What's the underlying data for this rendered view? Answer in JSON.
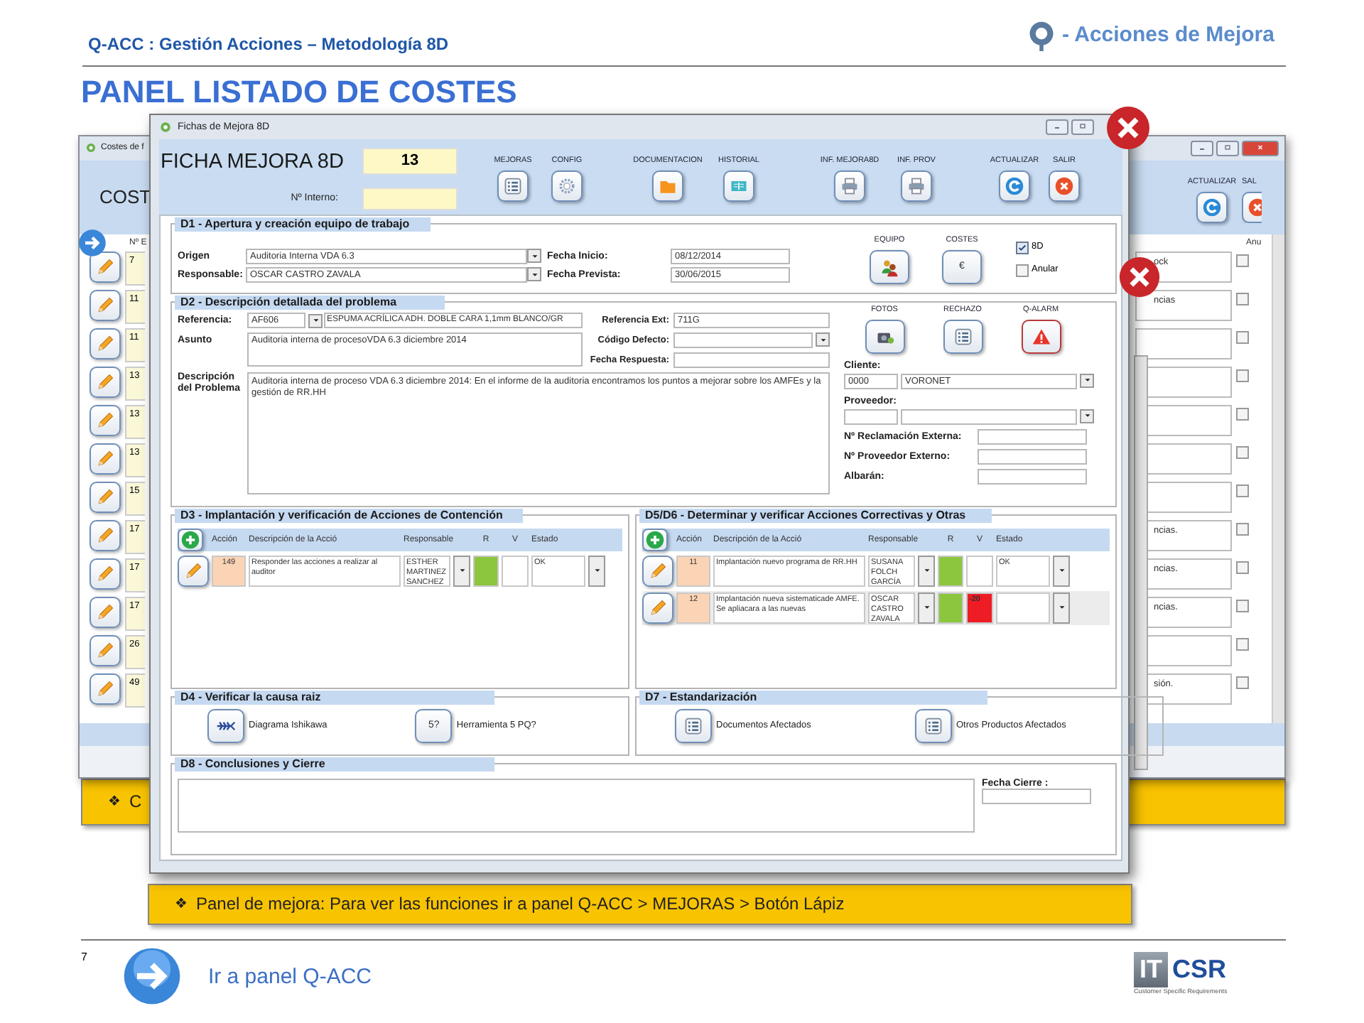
{
  "header": {
    "title": "Q-ACC : Gestión Acciones – Metodología 8D",
    "brand": "- Acciones de Mejora"
  },
  "slide_title": "PANEL LISTADO DE COSTES",
  "back_window": {
    "title": "Costes de f",
    "heading": "COST",
    "column_first": "Nº E",
    "column_last": "Anu",
    "toolbar": [
      {
        "label": "ACTUALIZAR",
        "kind": "refresh"
      },
      {
        "label": "SAL",
        "kind": "close"
      }
    ],
    "rows": [
      {
        "number": "7",
        "note": "ock",
        "annulled": false
      },
      {
        "number": "11",
        "note": "ncias",
        "annulled": false
      },
      {
        "number": "11",
        "annulled": false
      },
      {
        "number": "13",
        "annulled": false
      },
      {
        "number": "13",
        "annulled": false
      },
      {
        "number": "13",
        "annulled": false
      },
      {
        "number": "15",
        "annulled": false
      },
      {
        "number": "17",
        "note": "ncias.",
        "annulled": false
      },
      {
        "number": "17",
        "note": "ncias.",
        "annulled": false
      },
      {
        "number": "17",
        "note": "ncias.",
        "annulled": false
      },
      {
        "number": "26",
        "annulled": false
      },
      {
        "number": "49",
        "note": "sión.",
        "annulled": false
      }
    ]
  },
  "front_window": {
    "title": "Fichas de Mejora 8D",
    "heading": "FICHA MEJORA 8D",
    "number": "13",
    "internal_label": "Nº Interno:",
    "toolbar": [
      {
        "label": "MEJORAS",
        "kind": "list"
      },
      {
        "label": "CONFIG",
        "kind": "gear"
      },
      {
        "label": "DOCUMENTACION",
        "kind": "folder"
      },
      {
        "label": "HISTORIAL",
        "kind": "book"
      },
      {
        "label": "INF. MEJORA8D",
        "kind": "printer"
      },
      {
        "label": "INF. PROV",
        "kind": "printer"
      },
      {
        "label": "ACTUALIZAR",
        "kind": "refresh"
      },
      {
        "label": "SALIR",
        "kind": "close"
      }
    ],
    "d1": {
      "title": "D1 - Apertura y creación equipo de trabajo",
      "fields": [
        {
          "label": "Origen",
          "value": "Auditoria Interna VDA 6.3"
        },
        {
          "label": "Responsable:",
          "value": "OSCAR  CASTRO ZAVALA"
        }
      ],
      "dates": [
        {
          "label": "Fecha Inicio:",
          "value": "08/12/2014"
        },
        {
          "label": "Fecha Prevista:",
          "value": "30/06/2015"
        }
      ],
      "buttons": [
        {
          "label": "EQUIPO",
          "kind": "team"
        },
        {
          "label": "COSTES",
          "kind": "symbol",
          "symbol": "€"
        }
      ],
      "checks": [
        {
          "label": "8D",
          "checked": true
        },
        {
          "label": "Anular",
          "checked": false
        }
      ]
    },
    "d2": {
      "title": "D2 - Descripción detallada del problema",
      "reference_label": "Referencia:",
      "reference": "AF606",
      "reference_desc": "ESPUMA ACRÍLICA ADH. DOBLE CARA 1,1mm BLANCO/GR",
      "subject_label": "Asunto",
      "subject": "Auditoria interna de procesoVDA 6.3 diciembre 2014",
      "side_fields": [
        {
          "label": "Referencia Ext:",
          "value": "711G",
          "kind": "text"
        },
        {
          "label": "Código Defecto:",
          "kind": "dropdown"
        },
        {
          "label": "Fecha Respuesta:",
          "kind": "text"
        }
      ],
      "description_label": "Descripción del Problema",
      "description": "Auditoria interna de proceso VDA 6.3 diciembre 2014: En el informe de la auditoria encontramos los puntos a mejorar sobre los AMFEs y la gestión de RR.HH",
      "buttons": [
        {
          "label": "FOTOS",
          "kind": "camera"
        },
        {
          "label": "RECHAZO",
          "kind": "list"
        },
        {
          "label": "Q-ALARM",
          "kind": "alert"
        }
      ],
      "client_label": "Cliente:",
      "client_code": "0000",
      "client_name": "VORONET",
      "supplier_label": "Proveedor:",
      "extra_fields": [
        {
          "label": "Nº Reclamación Externa:"
        },
        {
          "label": "Nº Proveedor Externo:"
        },
        {
          "label": "Albarán:"
        }
      ]
    },
    "d3": {
      "title": "D3 - Implantación y verificación de Acciones de Contención",
      "columns": [
        "Acción",
        "Descripción de la Acció",
        "Responsable",
        "R",
        "V",
        "Estado"
      ],
      "rows": [
        {
          "number": "149",
          "description": "Responder las acciones a realizar al auditor",
          "responsible": "ESTHER MARTINEZ SANCHEZ",
          "r": {
            "color": "#8cc63e"
          },
          "v": {
            "color": "#ffffff"
          },
          "status": "OK",
          "selected": false
        }
      ]
    },
    "d5_d6": {
      "title": "D5/D6 - Determinar y verificar Acciones Correctivas y Otras",
      "columns": [
        "Acción",
        "Descripción de la Acció",
        "Responsable",
        "R",
        "V",
        "Estado"
      ],
      "rows": [
        {
          "number": "11",
          "description": "Implantación nuevo programa de RR.HH",
          "responsible": "SUSANA FOLCH GARCÍA",
          "r": {
            "color": "#8cc63e"
          },
          "v": {
            "color": "#ffffff"
          },
          "status": "OK",
          "selected": false
        },
        {
          "number": "12",
          "description": "Implantación nueva sistematicade AMFE. Se apliacara a las nuevas",
          "responsible": "OSCAR CASTRO ZAVALA",
          "r": {
            "color": "#8cc63e"
          },
          "v": {
            "color": "#ee1c24",
            "value": "-20"
          },
          "selected": true
        }
      ]
    },
    "d4": {
      "title": "D4 - Verificar la causa raiz",
      "tools": [
        {
          "kind": "fishbone",
          "label": "Diagrama Ishikawa"
        },
        {
          "kind": "symbol",
          "symbol": "5?",
          "label": "Herramienta 5 PQ?"
        }
      ]
    },
    "d7": {
      "title": "D7 - Estandarización",
      "tools": [
        {
          "kind": "list",
          "label": "Documentos Afectados"
        },
        {
          "kind": "list",
          "label": "Otros Productos Afectados"
        }
      ]
    },
    "d8": {
      "title": "D8 - Conclusiones y Cierre",
      "date_label": "Fecha Cierre :"
    }
  },
  "callouts": [
    {
      "bullet": "❖",
      "text": "C"
    },
    {
      "bullet": "❖",
      "text": "Panel de mejora: Para ver las funciones ir a panel Q-ACC > MEJORAS > Botón Lápiz"
    }
  ],
  "page_number": "7",
  "footer": {
    "link": "Ir a panel Q-ACC",
    "logo_mark": "IT",
    "logo_name": "CSR",
    "logo_caption": "Customer Specific Requirements"
  }
}
